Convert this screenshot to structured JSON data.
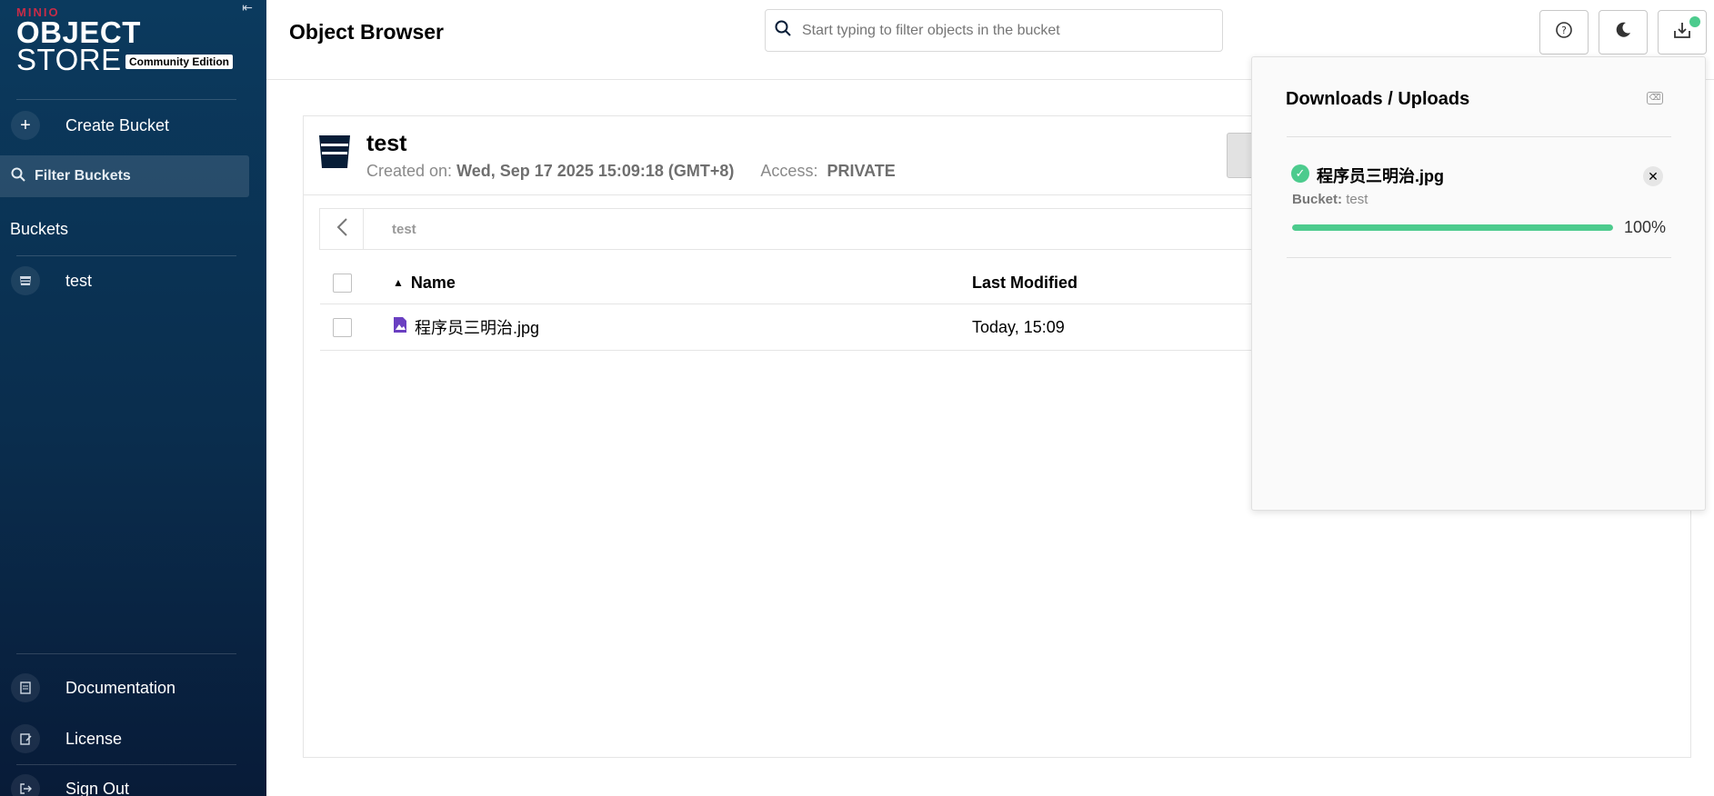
{
  "sidebar": {
    "logo_minio": "MINIO",
    "logo_object": "OBJECT",
    "logo_store": "STORE",
    "logo_edition": "Community Edition",
    "create_bucket_label": "Create Bucket",
    "filter_buckets_label": "Filter Buckets",
    "buckets_title": "Buckets",
    "buckets": [
      {
        "name": "test"
      }
    ],
    "documentation_label": "Documentation",
    "license_label": "License",
    "signout_label": "Sign Out"
  },
  "header": {
    "title": "Object Browser",
    "search_placeholder": "Start typing to filter objects in the bucket"
  },
  "bucket": {
    "name": "test",
    "created_label": "Created on:",
    "created_value": "Wed, Sep 17 2025 15:09:18 (GMT+8)",
    "access_label": "Access:",
    "access_value": "PRIVATE",
    "breadcrumb": "test"
  },
  "table": {
    "col_name": "Name",
    "col_modified": "Last Modified",
    "rows": [
      {
        "name": "程序员三明治.jpg",
        "modified": "Today, 15:09"
      }
    ]
  },
  "downloads": {
    "title": "Downloads / Uploads",
    "items": [
      {
        "file": "程序员三明治.jpg",
        "bucket_label": "Bucket:",
        "bucket": "test",
        "progress_pct": 100,
        "progress_text": "100%"
      }
    ]
  },
  "colors": {
    "accent_green": "#4ccb8d",
    "sidebar_bg": "#0a2d4d",
    "navy": "#071d37"
  }
}
